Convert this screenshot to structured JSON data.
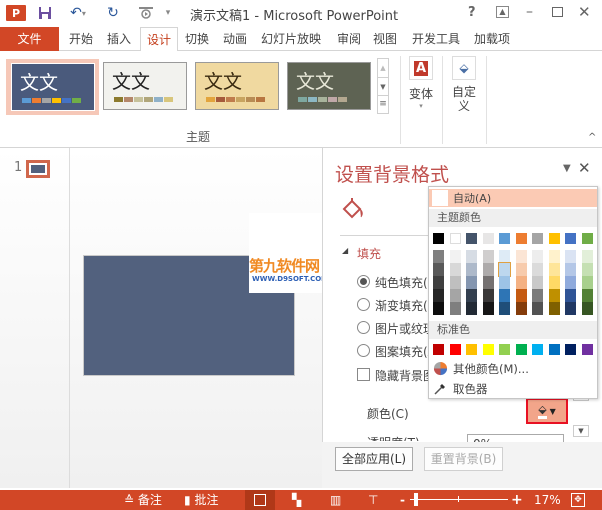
{
  "window": {
    "title": "演示文稿1 - Microsoft PowerPoint",
    "help": "?",
    "controls": {
      "ribbon_display": "⊡",
      "minimize": "–",
      "maximize": "□",
      "close": "✕"
    }
  },
  "quick_access": {
    "app_icon": "P",
    "save": "save-icon",
    "undo": "undo-icon",
    "redo": "redo-icon",
    "start_slideshow": "slideshow-icon",
    "customize": "▾"
  },
  "tabs": [
    {
      "label": "文件"
    },
    {
      "label": "开始"
    },
    {
      "label": "插入"
    },
    {
      "label": "设计"
    },
    {
      "label": "切换"
    },
    {
      "label": "动画"
    },
    {
      "label": "幻灯片放映"
    },
    {
      "label": "审阅"
    },
    {
      "label": "视图"
    },
    {
      "label": "开发工具"
    },
    {
      "label": "加载项"
    }
  ],
  "ribbon": {
    "themes": [
      {
        "sample": "文文",
        "bg": "#4a5a7c",
        "fg": "#ffffff",
        "swatches": [
          "#5b9bd5",
          "#ed7d31",
          "#a5a5a5",
          "#ffc000",
          "#4472c4",
          "#70ad47"
        ]
      },
      {
        "sample": "文文",
        "bg": "#f2f2ee",
        "fg": "#222222",
        "swatches": [
          "#8c7a2e",
          "#b4876a",
          "#c6c19a",
          "#b0a67a",
          "#8fb1c8",
          "#d8c67c"
        ]
      },
      {
        "sample": "文文",
        "bg": "#f0d9a0",
        "fg": "#3a2a10",
        "swatches": [
          "#e3a43c",
          "#a65a3a",
          "#c07c4c",
          "#c8a460",
          "#b88c54",
          "#b87640"
        ]
      },
      {
        "sample": "文文",
        "bg": "#5e6353",
        "fg": "#e8e8d8",
        "swatches": [
          "#7ea8a0",
          "#8cb8c4",
          "#a8b49c",
          "#c0a8a8",
          "#b4a890"
        ]
      }
    ],
    "group_label": "主题",
    "variants_label": "变体",
    "customize_label": "自定义",
    "collapse": "^"
  },
  "slides_pane": {
    "slide_number": "1",
    "slide_color": "#52617e"
  },
  "watermark": {
    "line1": "第九软件网",
    "line2": "WWW.D9SOFT.COM"
  },
  "format_panel": {
    "title": "设置背景格式",
    "section": "填充",
    "options": [
      {
        "label": "纯色填充(S)",
        "checked": true
      },
      {
        "label": "渐变填充(G)",
        "checked": false
      },
      {
        "label": "图片或纹理填充(P)",
        "checked": false
      },
      {
        "label": "图案填充(A)",
        "checked": false
      }
    ],
    "hide_bg_label": "隐藏背景图形(H)",
    "color_label": "颜色(C)",
    "transparency_label": "透明度(T)",
    "transparency_value": "0%",
    "apply_all": "全部应用(L)",
    "reset_bg": "重置背景(B)"
  },
  "color_menu": {
    "auto": "自动(A)",
    "theme_colors_label": "主题颜色",
    "theme_top": [
      "#000000",
      "#ffffff",
      "#44546a",
      "#e7e6e6",
      "#5b9bd5",
      "#ed7d31",
      "#a5a5a5",
      "#ffc000",
      "#4472c4",
      "#70ad47"
    ],
    "theme_shades": [
      [
        "#7f7f7f",
        "#595959",
        "#3f3f3f",
        "#262626",
        "#0d0d0d"
      ],
      [
        "#f2f2f2",
        "#d8d8d8",
        "#bfbfbf",
        "#a5a5a5",
        "#7f7f7f"
      ],
      [
        "#d6dce4",
        "#adb9ca",
        "#8496b0",
        "#333f4f",
        "#222a35"
      ],
      [
        "#d0cece",
        "#aeabab",
        "#757171",
        "#3a3838",
        "#171616"
      ],
      [
        "#deebf6",
        "#bdd7ee",
        "#9dc3e6",
        "#2e75b5",
        "#1f4e79"
      ],
      [
        "#fbe5d5",
        "#f7cbac",
        "#f4b183",
        "#c55a11",
        "#843c0b"
      ],
      [
        "#ededed",
        "#dbdbdb",
        "#c9c9c9",
        "#7b7b7b",
        "#525252"
      ],
      [
        "#fff2cc",
        "#fee599",
        "#ffd965",
        "#bf9000",
        "#7f6000"
      ],
      [
        "#dae3f3",
        "#b4c7e7",
        "#8faadc",
        "#2f5496",
        "#203864"
      ],
      [
        "#e2efd9",
        "#c5e0b3",
        "#a8d08d",
        "#538135",
        "#375623"
      ]
    ],
    "standard_label": "标准色",
    "standard": [
      "#c00000",
      "#ff0000",
      "#ffc000",
      "#ffff00",
      "#92d050",
      "#00b050",
      "#00b0f0",
      "#0070c0",
      "#002060",
      "#7030a0"
    ],
    "more_colors": "其他颜色(M)...",
    "eyedropper": "取色器"
  },
  "statusbar": {
    "notes": "备注",
    "comments": "批注",
    "zoom_minus": "-",
    "zoom_plus": "+",
    "zoom_level": "17%",
    "zoom_fraction": 0.17
  },
  "colors": {
    "accent": "#d24726",
    "accent_text": "#c43e1c",
    "highlight": "#fbcab4",
    "selected_border": "#e81123"
  }
}
